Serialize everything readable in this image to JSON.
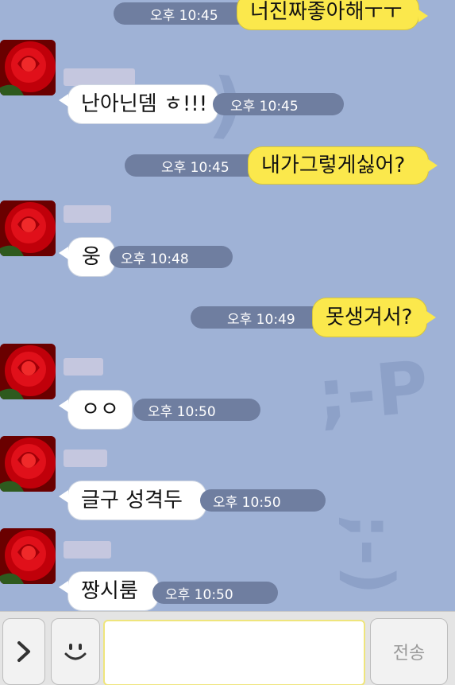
{
  "messages": [
    {
      "side": "me",
      "text": "너진짜좋아해ㅜㅜ",
      "time": "오후 10:45"
    },
    {
      "side": "other",
      "text": "난아닌뎀 ㅎ!!!",
      "time": "오후 10:45"
    },
    {
      "side": "me",
      "text": "내가그렇게싫어?",
      "time": "오후 10:45"
    },
    {
      "side": "other",
      "text": "웅",
      "time": "오후 10:48"
    },
    {
      "side": "me",
      "text": "못생겨서?",
      "time": "오후 10:49"
    },
    {
      "side": "other",
      "text": "ㅇㅇ",
      "time": "오후 10:50"
    },
    {
      "side": "other",
      "text": "글구 성격두",
      "time": "오후 10:50"
    },
    {
      "side": "other",
      "text": "짱시룸",
      "time": "오후 10:50"
    }
  ],
  "watermarks": {
    "wm1": ";-P",
    "wm2": ";-)"
  },
  "input": {
    "send_label": "전송",
    "placeholder": ""
  },
  "icons": {
    "expand": "chevron-right-icon",
    "emoticon": "smiley-icon",
    "avatar": "red-rose-avatar"
  },
  "colors": {
    "chat_bg": "#9fb2d6",
    "my_bubble": "#fbe84c",
    "their_bubble": "#ffffff",
    "time_pill": "#6f7ea0"
  }
}
